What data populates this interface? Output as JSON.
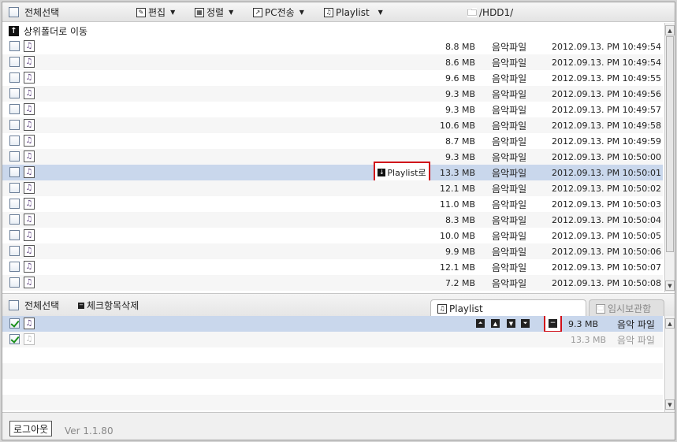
{
  "toolbar": {
    "select_all": "전체선택",
    "edit": "편집",
    "sort": "정렬",
    "pc_transfer": "PC전송",
    "playlist": "Playlist",
    "path": "/HDD1/"
  },
  "upper": {
    "parent_folder": "상위폴더로 이동",
    "playlist_button": "Playlist로",
    "files": [
      {
        "size": "8.8 MB",
        "type": "음악파일",
        "date": "2012.09.13. PM 10:49:54"
      },
      {
        "size": "8.6 MB",
        "type": "음악파일",
        "date": "2012.09.13. PM 10:49:54"
      },
      {
        "size": "9.6 MB",
        "type": "음악파일",
        "date": "2012.09.13. PM 10:49:55"
      },
      {
        "size": "9.3 MB",
        "type": "음악파일",
        "date": "2012.09.13. PM 10:49:56"
      },
      {
        "size": "9.3 MB",
        "type": "음악파일",
        "date": "2012.09.13. PM 10:49:57"
      },
      {
        "size": "10.6 MB",
        "type": "음악파일",
        "date": "2012.09.13. PM 10:49:58"
      },
      {
        "size": "8.7 MB",
        "type": "음악파일",
        "date": "2012.09.13. PM 10:49:59"
      },
      {
        "size": "9.3 MB",
        "type": "음악파일",
        "date": "2012.09.13. PM 10:50:00"
      },
      {
        "size": "13.3 MB",
        "type": "음악파일",
        "date": "2012.09.13. PM 10:50:01"
      },
      {
        "size": "12.1 MB",
        "type": "음악파일",
        "date": "2012.09.13. PM 10:50:02"
      },
      {
        "size": "11.0 MB",
        "type": "음악파일",
        "date": "2012.09.13. PM 10:50:03"
      },
      {
        "size": "8.3 MB",
        "type": "음악파일",
        "date": "2012.09.13. PM 10:50:04"
      },
      {
        "size": "10.0 MB",
        "type": "음악파일",
        "date": "2012.09.13. PM 10:50:05"
      },
      {
        "size": "9.9 MB",
        "type": "음악파일",
        "date": "2012.09.13. PM 10:50:06"
      },
      {
        "size": "12.1 MB",
        "type": "음악파일",
        "date": "2012.09.13. PM 10:50:07"
      },
      {
        "size": "7.2 MB",
        "type": "음악파일",
        "date": "2012.09.13. PM 10:50:08"
      }
    ]
  },
  "lower": {
    "select_all": "전체선택",
    "delete_checked": "체크항목삭제",
    "tab_playlist": "Playlist",
    "tab_temp": "임시보관함",
    "items": [
      {
        "size": "9.3 MB",
        "type": "음악 파일"
      },
      {
        "size": "13.3 MB",
        "type": "음악 파일"
      }
    ]
  },
  "footer": {
    "logout": "로그아웃",
    "version": "Ver 1.1.80"
  }
}
